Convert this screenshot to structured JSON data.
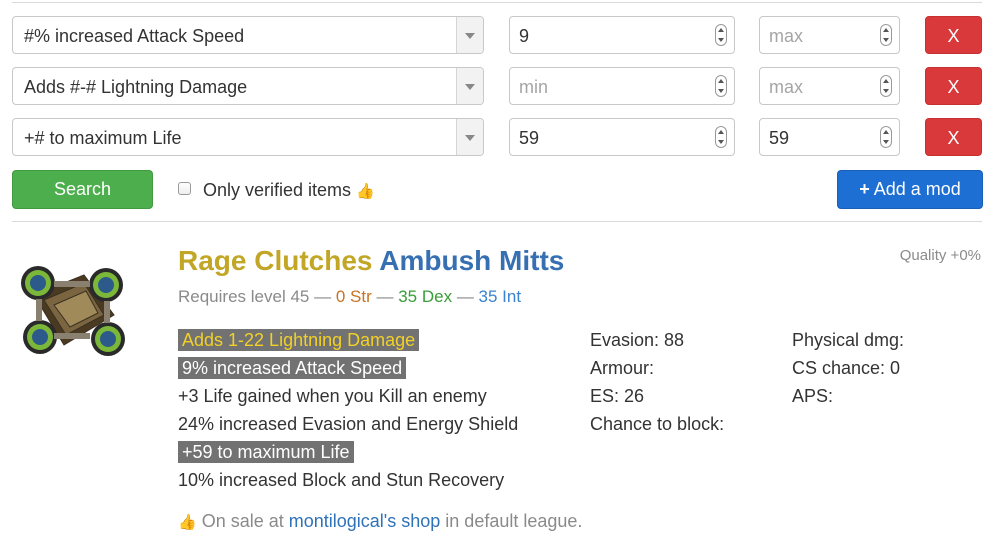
{
  "filters": [
    {
      "mod": "#% increased Attack Speed",
      "min": "9",
      "min_placeholder": "min",
      "max": "",
      "max_placeholder": "max",
      "remove": "X"
    },
    {
      "mod": "Adds #-# Lightning Damage",
      "min": "",
      "min_placeholder": "min",
      "max": "",
      "max_placeholder": "max",
      "remove": "X"
    },
    {
      "mod": "+# to maximum Life",
      "min": "59",
      "min_placeholder": "min",
      "max": "59",
      "max_placeholder": "max",
      "remove": "X"
    }
  ],
  "actions": {
    "search_label": "Search",
    "verified_label": "Only verified items",
    "verified_checked": false,
    "add_mod_label": "Add a mod"
  },
  "item": {
    "name_prefix": "Rage Clutches",
    "name_base": "Ambush Mitts",
    "quality": "Quality +0%",
    "requires": {
      "prefix": "Requires level 45",
      "str": "0 Str",
      "dex": "35 Dex",
      "int": "35 Int"
    },
    "mods": [
      {
        "text": "Adds 1-22 Lightning Damage",
        "highlight": "yellow"
      },
      {
        "text": "9% increased Attack Speed",
        "highlight": "gray"
      },
      {
        "text": "+3 Life gained when you Kill an enemy",
        "highlight": "none"
      },
      {
        "text": "24% increased Evasion and Energy Shield",
        "highlight": "none"
      },
      {
        "text": "+59 to maximum Life",
        "highlight": "gray"
      },
      {
        "text": "10% increased Block and Stun Recovery",
        "highlight": "none"
      }
    ],
    "defense": [
      "Evasion: 88",
      "Armour:",
      "ES: 26",
      "Chance to block:"
    ],
    "offense": [
      "Physical dmg:",
      "CS chance: 0",
      "APS:"
    ],
    "sale": {
      "prefix": "On sale at",
      "shop": "montilogical's shop",
      "suffix": "in default league."
    }
  }
}
